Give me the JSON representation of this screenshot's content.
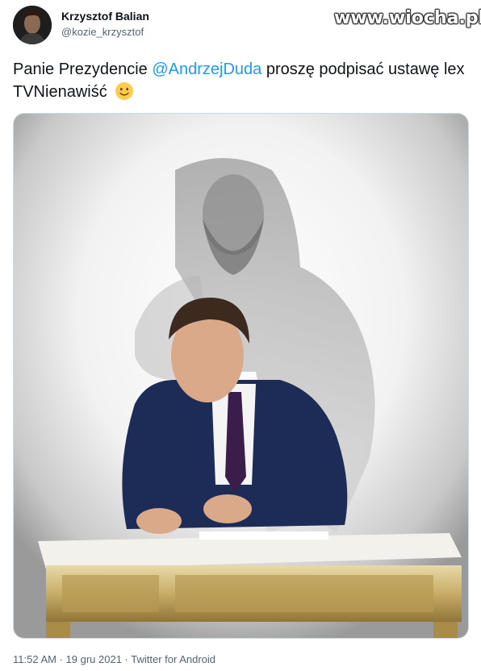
{
  "watermark": "www.wiocha.pl",
  "author": {
    "name": "Krzysztof Balian",
    "handle": "@kozie_krzysztof"
  },
  "tweet": {
    "text_before": "Panie Prezydencie ",
    "mention": "@AndrzejDuda",
    "text_after": "  proszę podpisać ustawę lex TVNienawiść",
    "emoji": "slightly-smiling-face-icon"
  },
  "meta": {
    "time": "11:52 AM",
    "sep1": " · ",
    "date": "19 gru 2021",
    "sep2": " · ",
    "source": "Twitter for Android"
  }
}
